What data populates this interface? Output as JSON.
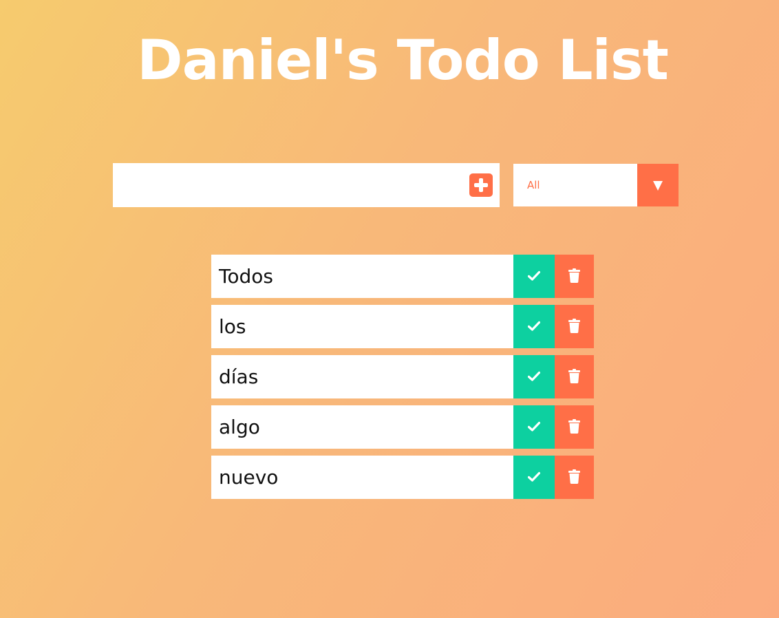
{
  "page": {
    "title": "Daniel's Todo List"
  },
  "form": {
    "input_value": "",
    "input_placeholder": "",
    "add_icon": "plus-square-icon"
  },
  "filter": {
    "selected": "All",
    "arrow_icon": "caret-down-icon"
  },
  "todos": [
    {
      "text": "Todos"
    },
    {
      "text": "los"
    },
    {
      "text": "días"
    },
    {
      "text": "algo"
    },
    {
      "text": "nuevo"
    }
  ],
  "icons": {
    "complete": "check-icon",
    "delete": "trash-icon"
  },
  "colors": {
    "accent": "#ff6f47",
    "complete": "#0dd0a0",
    "gradient_start": "#f6cb6e",
    "gradient_end": "#fbab7e"
  }
}
